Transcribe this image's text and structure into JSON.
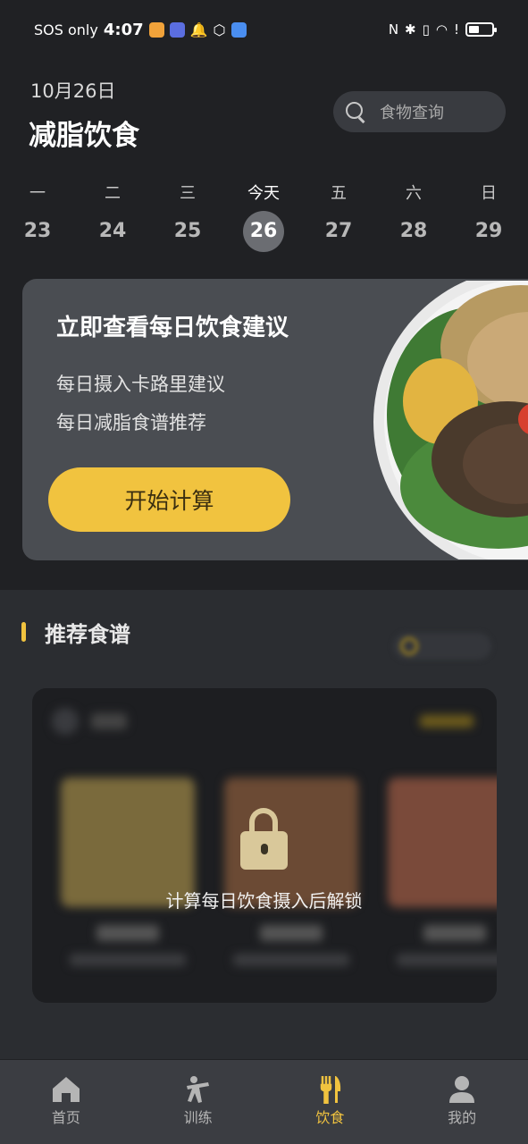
{
  "status_bar": {
    "carrier": "SOS only",
    "time": "4:07",
    "battery_level": 0.45
  },
  "header": {
    "date": "10月26日",
    "title": "减脂饮食",
    "search_placeholder": "食物查询"
  },
  "week": [
    {
      "weekday": "一",
      "day": "23",
      "today": false
    },
    {
      "weekday": "二",
      "day": "24",
      "today": false
    },
    {
      "weekday": "三",
      "day": "25",
      "today": false
    },
    {
      "weekday": "今天",
      "day": "26",
      "today": true
    },
    {
      "weekday": "五",
      "day": "27",
      "today": false
    },
    {
      "weekday": "六",
      "day": "28",
      "today": false
    },
    {
      "weekday": "日",
      "day": "29",
      "today": false
    }
  ],
  "promo": {
    "title": "立即查看每日饮食建议",
    "line1": "每日摄入卡路里建议",
    "line2": "每日减脂食谱推荐",
    "button": "开始计算"
  },
  "recommend": {
    "title": "推荐食谱",
    "unlock_text": "计算每日饮食摄入后解锁"
  },
  "nav": {
    "tabs": [
      {
        "label": "首页",
        "icon": "home-icon",
        "active": false
      },
      {
        "label": "训练",
        "icon": "exercise-icon",
        "active": false
      },
      {
        "label": "饮食",
        "icon": "fork-knife-icon",
        "active": true
      },
      {
        "label": "我的",
        "icon": "person-icon",
        "active": false
      }
    ]
  },
  "colors": {
    "accent": "#f1c33f",
    "background": "#202124",
    "card": "#4a4d52"
  }
}
